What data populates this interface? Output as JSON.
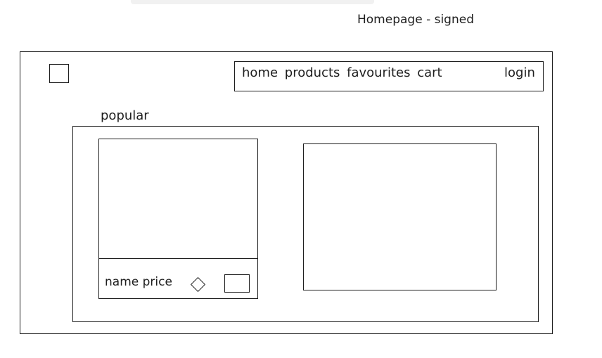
{
  "page_label": "Homepage - signed",
  "header": {
    "nav": {
      "home": "home",
      "products": "products",
      "favourites": "favourites",
      "cart": "cart",
      "login": "login"
    }
  },
  "popular": {
    "label": "popular",
    "card": {
      "name": "name",
      "price": "price"
    }
  }
}
